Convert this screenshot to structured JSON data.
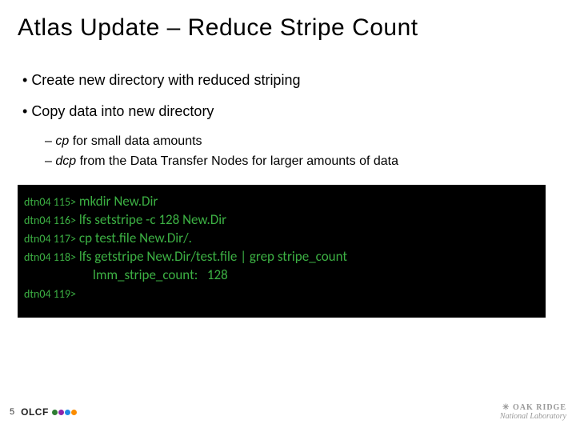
{
  "title": "Atlas Update – Reduce Stripe Count",
  "bullets": {
    "b1": "Create new directory with reduced striping",
    "b2": "Copy data into new directory",
    "sub1_em": "cp",
    "sub1_rest": " for small data amounts",
    "sub2_em": "dcp",
    "sub2_rest": " from the Data Transfer Nodes for larger amounts of data"
  },
  "terminal": {
    "p1": "dtn04 115>",
    "c1": " mkdir New.Dir",
    "p2": "dtn04 116>",
    "c2": " lfs setstripe -c 128 New.Dir",
    "p3": "dtn04 117>",
    "c3": " cp test.file New.Dir/.",
    "p4": "dtn04 118>",
    "c4": " lfs getstripe New.Dir/test.file | grep stripe_count",
    "out": "lmm_stripe_count:   128",
    "p5": "dtn04 119>"
  },
  "footer": {
    "page": "5",
    "olcf": "OLCF",
    "ornl_top": "OAK RIDGE",
    "ornl_bot": "National Laboratory"
  }
}
